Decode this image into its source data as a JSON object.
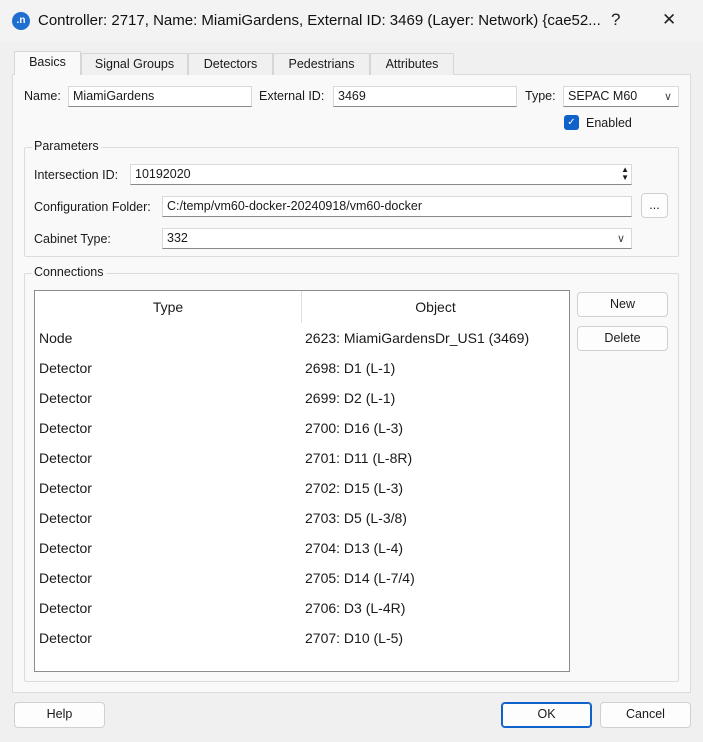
{
  "window": {
    "title": "Controller: 2717, Name: MiamiGardens, External ID: 3469 (Layer: Network) {cae52...",
    "app_icon": ".n",
    "help_glyph": "?",
    "close_glyph": "✕"
  },
  "tabs": [
    {
      "label": "Basics",
      "selected": true
    },
    {
      "label": "Signal Groups"
    },
    {
      "label": "Detectors"
    },
    {
      "label": "Pedestrians"
    },
    {
      "label": "Attributes"
    }
  ],
  "basics": {
    "name_label": "Name:",
    "name_value": "MiamiGardens",
    "external_id_label": "External ID:",
    "external_id_value": "3469",
    "type_label": "Type:",
    "type_value": "SEPAC M60",
    "enabled_label": "Enabled",
    "enabled": true
  },
  "parameters": {
    "title": "Parameters",
    "intersection_id_label": "Intersection ID:",
    "intersection_id_value": "10192020",
    "config_folder_label": "Configuration Folder:",
    "config_folder_value": "C:/temp/vm60-docker-20240918/vm60-docker",
    "browse_label": "...",
    "cabinet_type_label": "Cabinet Type:",
    "cabinet_type_value": "332"
  },
  "connections": {
    "title": "Connections",
    "columns": [
      "Type",
      "Object"
    ],
    "rows": [
      [
        "Node",
        "2623: MiamiGardensDr_US1 (3469)"
      ],
      [
        "Detector",
        "2698: D1 (L-1)"
      ],
      [
        "Detector",
        "2699: D2 (L-1)"
      ],
      [
        "Detector",
        "2700: D16 (L-3)"
      ],
      [
        "Detector",
        "2701: D11 (L-8R)"
      ],
      [
        "Detector",
        "2702: D15 (L-3)"
      ],
      [
        "Detector",
        "2703: D5 (L-3/8)"
      ],
      [
        "Detector",
        "2704: D13 (L-4)"
      ],
      [
        "Detector",
        "2705: D14 (L-7/4)"
      ],
      [
        "Detector",
        "2706: D3 (L-4R)"
      ],
      [
        "Detector",
        "2707: D10 (L-5)"
      ]
    ],
    "new_label": "New",
    "delete_label": "Delete"
  },
  "footer": {
    "help_label": "Help",
    "ok_label": "OK",
    "cancel_label": "Cancel"
  },
  "colors": {
    "accent": "#0f62c9"
  }
}
